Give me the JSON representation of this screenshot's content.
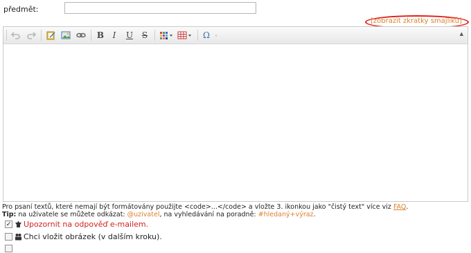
{
  "subject": {
    "label": "předmět:",
    "value": ""
  },
  "smileys_link": "[zobrazit zkratky smajlíků]",
  "toolbar": {
    "bold": "B",
    "italic": "I",
    "underline": "U",
    "strike": "S",
    "omega": "Ω",
    "collapse": "▲"
  },
  "hint": {
    "text": "Pro psaní textů, které nemají být formátovány použijte <code>...</code> a vložte 3. ikonkou jako \"čistý text\" více viz",
    "faq": "FAQ",
    "end": "."
  },
  "tip": {
    "label": "Tip:",
    "t1": " na uživatele se můžete odkázat: ",
    "user": "@uzivatel",
    "t2": ", na vyhledávání na poradně: ",
    "search": "#hledaný+výraz",
    "t3": "."
  },
  "options": [
    {
      "label": "Upozornit na odpověď e-mailem.",
      "checked": true,
      "color": "#d11f1f"
    },
    {
      "label": "Chci vložit obrázek (v dalším kroku).",
      "checked": false,
      "color": "#222222"
    }
  ]
}
